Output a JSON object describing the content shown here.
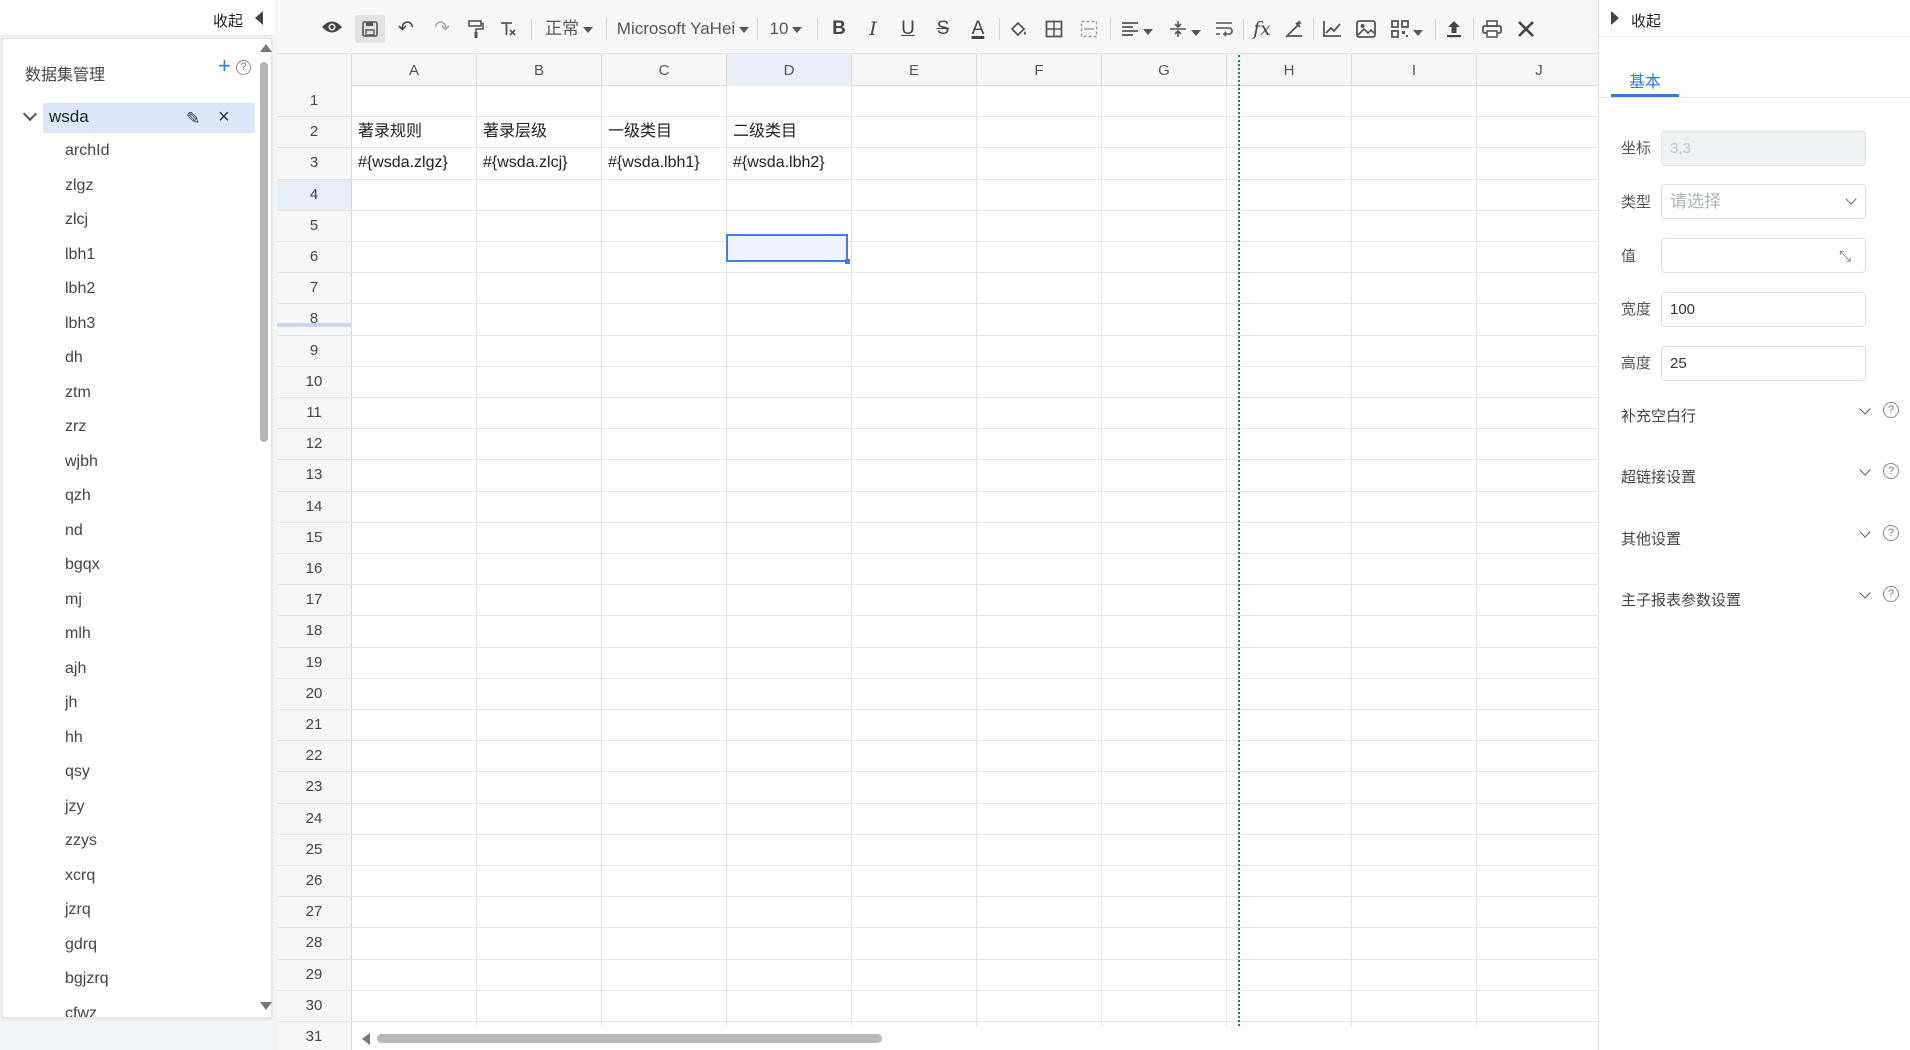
{
  "left_panel": {
    "collapse_label": "收起",
    "dataset_title": "数据集管理",
    "add_symbol": "+",
    "help_symbol": "?",
    "dataset": {
      "name": "wsda",
      "fields": [
        "archId",
        "zlgz",
        "zlcj",
        "lbh1",
        "lbh2",
        "lbh3",
        "dh",
        "ztm",
        "zrz",
        "wjbh",
        "qzh",
        "nd",
        "bgqx",
        "mj",
        "mlh",
        "ajh",
        "jh",
        "hh",
        "qsy",
        "jzy",
        "zzys",
        "xcrq",
        "jzrq",
        "gdrq",
        "bgjzrq",
        "cfwz"
      ]
    }
  },
  "toolbar": {
    "preview_icon": "eye-icon",
    "save_icon": "save-icon",
    "undo_icon": "undo-icon",
    "redo_icon": "redo-icon",
    "format_painter_icon": "paint-roller-icon",
    "clear_format_icon": "clear-format-icon",
    "text_style": "正常",
    "font_family": "Microsoft YaHei",
    "font_size": "10",
    "bold": "B",
    "italic": "I",
    "underline": "U",
    "strike": "S",
    "font_color": "A",
    "formula": "fx"
  },
  "sheet": {
    "columns": [
      "A",
      "B",
      "C",
      "D",
      "E",
      "F",
      "G",
      "H",
      "I",
      "J"
    ],
    "selected_column": "D",
    "selected_row": 4,
    "row_count": 31,
    "cells": {
      "2": [
        "著录规则",
        "著录层级",
        "一级类目",
        "二级类目"
      ],
      "3": [
        "#{wsda.zlgz}",
        "#{wsda.zlcj}",
        "#{wsda.lbh1}",
        "#{wsda.lbh2}"
      ]
    }
  },
  "right_panel": {
    "collapse_label": "收起",
    "tab_basic": "基本",
    "coordinate_label": "坐标",
    "coordinate_value": "3,3",
    "type_label": "类型",
    "type_placeholder": "请选择",
    "value_label": "值",
    "value_value": "",
    "width_label": "宽度",
    "width_value": "100",
    "height_label": "高度",
    "height_value": "25",
    "sections": [
      "补充空白行",
      "超链接设置",
      "其他设置",
      "主子报表参数设置"
    ]
  }
}
